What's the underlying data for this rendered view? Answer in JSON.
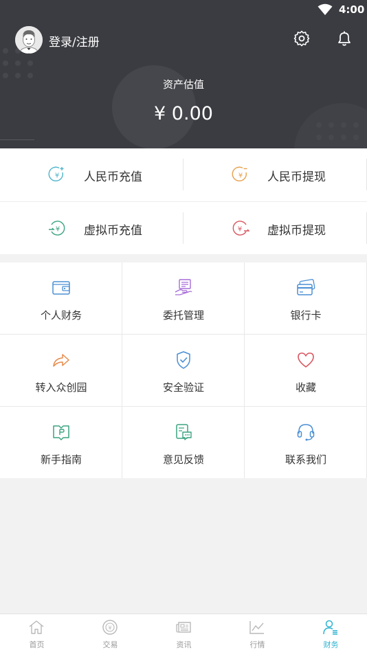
{
  "status_bar": {
    "time": "4:00"
  },
  "header": {
    "login_label": "登录/注册",
    "asset_label": "资产估值",
    "asset_value": "¥ 0.00",
    "icons": [
      "settings-icon",
      "bell-icon"
    ]
  },
  "money_actions": [
    {
      "label": "人民币充值",
      "icon": "cny-deposit-icon",
      "color": "#4fb5c9"
    },
    {
      "label": "人民币提现",
      "icon": "cny-withdraw-icon",
      "color": "#e7a04c"
    },
    {
      "label": "虚拟币充值",
      "icon": "crypto-deposit-icon",
      "color": "#3aa37f"
    },
    {
      "label": "虚拟币提现",
      "icon": "crypto-withdraw-icon",
      "color": "#d9555f"
    }
  ],
  "menu": [
    {
      "label": "个人财务",
      "icon": "wallet-icon",
      "color": "#4a8fd4"
    },
    {
      "label": "委托管理",
      "icon": "order-hand-icon",
      "color": "#a66bd8"
    },
    {
      "label": "银行卡",
      "icon": "bank-card-icon",
      "color": "#4a8fd4"
    },
    {
      "label": "转入众创园",
      "icon": "share-arrow-icon",
      "color": "#e88a4a"
    },
    {
      "label": "安全验证",
      "icon": "shield-check-icon",
      "color": "#4a8fd4"
    },
    {
      "label": "收藏",
      "icon": "heart-icon",
      "color": "#d9555f"
    },
    {
      "label": "新手指南",
      "icon": "guide-book-icon",
      "color": "#3aa37f"
    },
    {
      "label": "意见反馈",
      "icon": "feedback-icon",
      "color": "#3aa37f"
    },
    {
      "label": "联系我们",
      "icon": "headset-icon",
      "color": "#4a8fd4"
    }
  ],
  "tabs": [
    {
      "label": "首页",
      "icon": "home-icon",
      "active": false
    },
    {
      "label": "交易",
      "icon": "trade-icon",
      "active": false
    },
    {
      "label": "资讯",
      "icon": "news-icon",
      "active": false
    },
    {
      "label": "行情",
      "icon": "chart-icon",
      "active": false
    },
    {
      "label": "财务",
      "icon": "finance-user-icon",
      "active": true
    }
  ],
  "colors": {
    "header_bg": "#3b3c41",
    "active_tab": "#2fb3d1",
    "inactive_tab": "#b8b8b8"
  }
}
